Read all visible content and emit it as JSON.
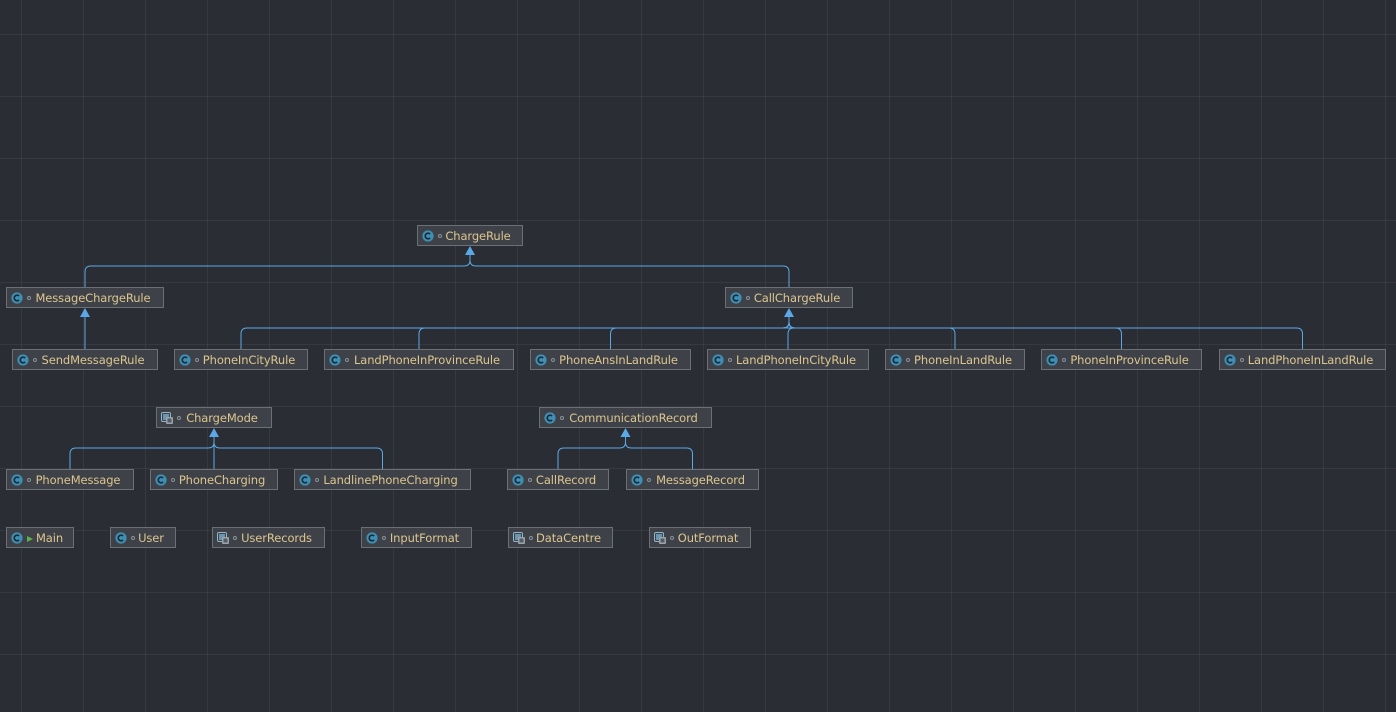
{
  "diagram": {
    "nodes": [
      {
        "id": "chargerule",
        "label": "ChargeRule",
        "kind": "class",
        "icon": "class-icon"
      },
      {
        "id": "messagechargerule",
        "label": "MessageChargeRule",
        "kind": "class",
        "icon": "class-icon"
      },
      {
        "id": "callchargerule",
        "label": "CallChargeRule",
        "kind": "class",
        "icon": "class-icon"
      },
      {
        "id": "sendmessagerule",
        "label": "SendMessageRule",
        "kind": "class",
        "icon": "class-icon"
      },
      {
        "id": "phoneincityrule",
        "label": "PhoneInCityRule",
        "kind": "class",
        "icon": "class-icon"
      },
      {
        "id": "landphoneinprovincerule",
        "label": "LandPhoneInProvinceRule",
        "kind": "class",
        "icon": "class-icon"
      },
      {
        "id": "phoneansinlandrule",
        "label": "PhoneAnsInLandRule",
        "kind": "class",
        "icon": "class-icon"
      },
      {
        "id": "landphoneincityrule",
        "label": "LandPhoneInCityRule",
        "kind": "class",
        "icon": "class-icon"
      },
      {
        "id": "phoneinlandrule",
        "label": "PhoneInLandRule",
        "kind": "class",
        "icon": "class-icon"
      },
      {
        "id": "phoneinprovincerule",
        "label": "PhoneInProvinceRule",
        "kind": "class",
        "icon": "class-icon"
      },
      {
        "id": "landphoneinlandrule",
        "label": "LandPhoneInLandRule",
        "kind": "class",
        "icon": "class-icon"
      },
      {
        "id": "chargemode",
        "label": "ChargeMode",
        "kind": "abstract",
        "icon": "abstract-class-icon"
      },
      {
        "id": "communicationrecord",
        "label": "CommunicationRecord",
        "kind": "class",
        "icon": "class-icon"
      },
      {
        "id": "phonemessage",
        "label": "PhoneMessage",
        "kind": "class",
        "icon": "class-icon"
      },
      {
        "id": "phonecharging",
        "label": "PhoneCharging",
        "kind": "class",
        "icon": "class-icon"
      },
      {
        "id": "landlinephonecharging",
        "label": "LandlinePhoneCharging",
        "kind": "class",
        "icon": "class-icon"
      },
      {
        "id": "callrecord",
        "label": "CallRecord",
        "kind": "class",
        "icon": "class-icon"
      },
      {
        "id": "messagerecord",
        "label": "MessageRecord",
        "kind": "class",
        "icon": "class-icon"
      },
      {
        "id": "main",
        "label": "Main",
        "kind": "main",
        "icon": "main-class-icon"
      },
      {
        "id": "user",
        "label": "User",
        "kind": "class",
        "icon": "class-icon"
      },
      {
        "id": "userrecords",
        "label": "UserRecords",
        "kind": "abstract",
        "icon": "abstract-class-icon"
      },
      {
        "id": "inputformat",
        "label": "InputFormat",
        "kind": "class",
        "icon": "class-icon"
      },
      {
        "id": "datacentre",
        "label": "DataCentre",
        "kind": "abstract",
        "icon": "abstract-class-icon"
      },
      {
        "id": "outformat",
        "label": "OutFormat",
        "kind": "abstract",
        "icon": "abstract-class-icon"
      }
    ],
    "edges": [
      {
        "child": "messagechargerule",
        "parent": "chargerule"
      },
      {
        "child": "callchargerule",
        "parent": "chargerule"
      },
      {
        "child": "sendmessagerule",
        "parent": "messagechargerule"
      },
      {
        "child": "phoneincityrule",
        "parent": "callchargerule"
      },
      {
        "child": "landphoneinprovincerule",
        "parent": "callchargerule"
      },
      {
        "child": "phoneansinlandrule",
        "parent": "callchargerule"
      },
      {
        "child": "landphoneincityrule",
        "parent": "callchargerule"
      },
      {
        "child": "phoneinlandrule",
        "parent": "callchargerule"
      },
      {
        "child": "phoneinprovincerule",
        "parent": "callchargerule"
      },
      {
        "child": "landphoneinlandrule",
        "parent": "callchargerule"
      },
      {
        "child": "phonemessage",
        "parent": "chargemode"
      },
      {
        "child": "phonecharging",
        "parent": "chargemode"
      },
      {
        "child": "landlinephonecharging",
        "parent": "chargemode"
      },
      {
        "child": "callrecord",
        "parent": "communicationrecord"
      },
      {
        "child": "messagerecord",
        "parent": "communicationrecord"
      }
    ]
  },
  "colors": {
    "background": "#2b2d34",
    "node_fill": "#3e4248",
    "node_border": "#6b7077",
    "label_text": "#dcc58f",
    "edge": "#5aa9e6",
    "class_icon": "#3d8fb5",
    "main_marker": "#5fb04a"
  }
}
